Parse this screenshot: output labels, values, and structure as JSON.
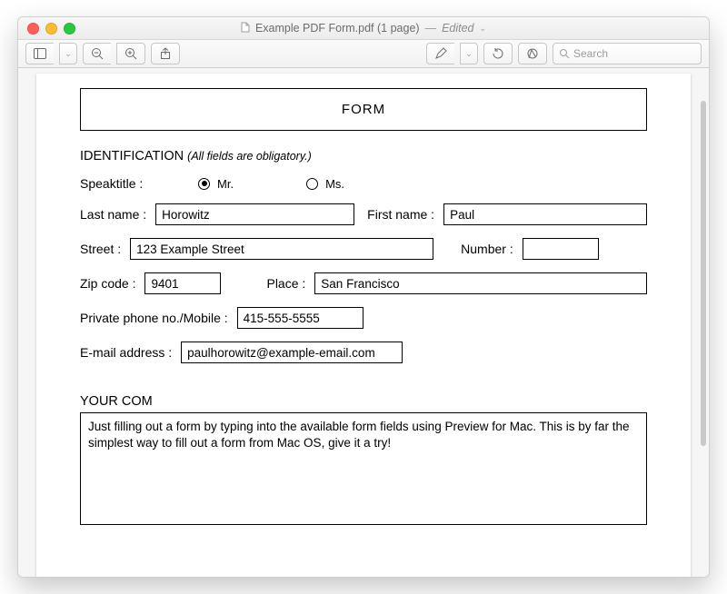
{
  "window": {
    "title": "Example PDF Form.pdf (1 page)",
    "status": "Edited"
  },
  "toolbar": {
    "search_placeholder": "Search"
  },
  "form": {
    "heading": "FORM",
    "section_id_label": "IDENTIFICATION",
    "section_id_hint": "(All fields are obligatory.)",
    "speaktitle_label": "Speaktitle :",
    "speaktitle_options": {
      "mr": "Mr.",
      "ms": "Ms."
    },
    "speaktitle_selected": "mr",
    "lastname_label": "Last name :",
    "lastname_value": "Horowitz",
    "firstname_label": "First name :",
    "firstname_value": "Paul",
    "street_label": "Street :",
    "street_value": "123 Example Street",
    "number_label": "Number :",
    "number_value": "",
    "zip_label": "Zip code :",
    "zip_value": "9401",
    "place_label": "Place :",
    "place_value": "San Francisco",
    "phone_label": "Private phone no./Mobile  :",
    "phone_value": "415-555-5555",
    "email_label": "E-mail address :",
    "email_value": "paulhorowitz@example-email.com",
    "comments_label": "YOUR COM",
    "comments_value": "Just filling out a form by typing into the available form fields using Preview for Mac. This is by far the simplest way to fill out a form from Mac OS, give it a try!"
  }
}
